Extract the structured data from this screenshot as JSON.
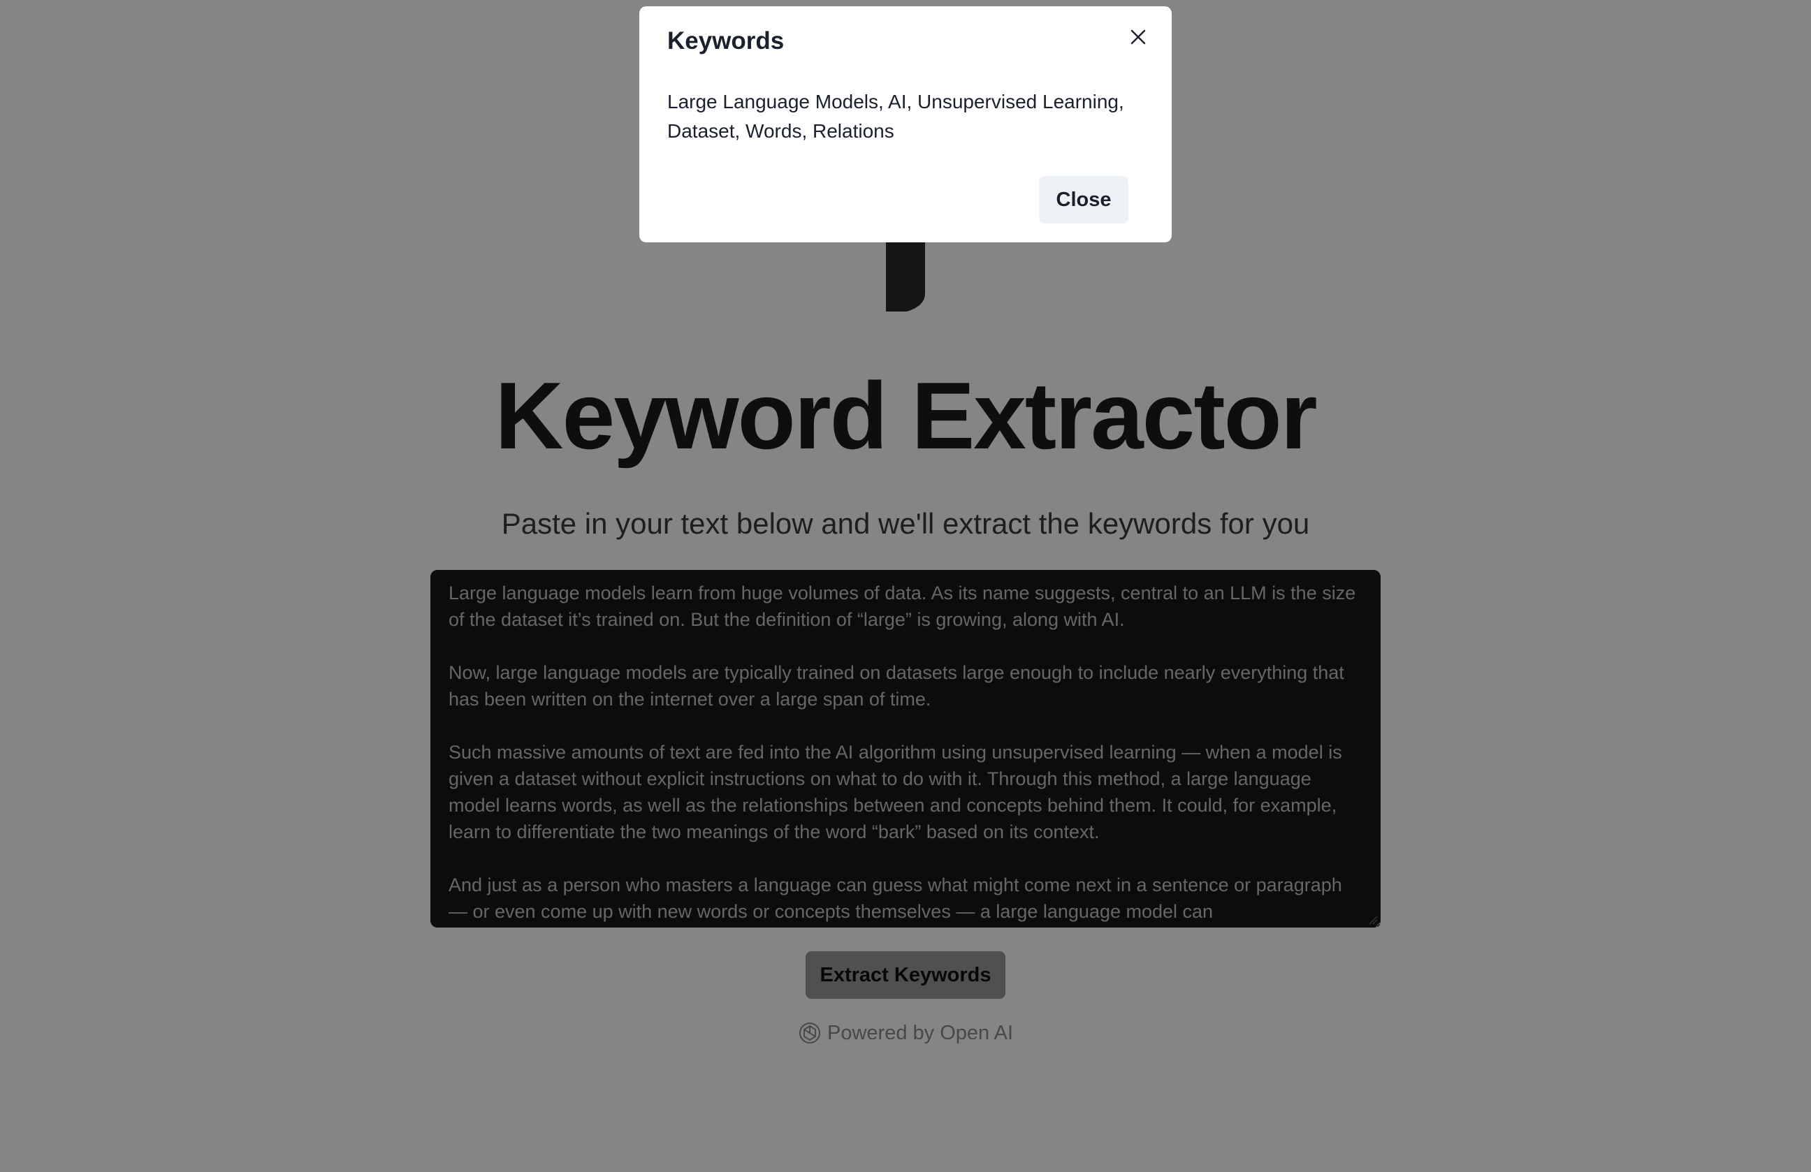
{
  "app": {
    "title": "Keyword Extractor",
    "subtitle": "Paste in your text below and we'll extract the keywords for you",
    "input_text": "Large language models learn from huge volumes of data. As its name suggests, central to an LLM is the size of the dataset it’s trained on. But the definition of “large” is growing, along with AI.\n\nNow, large language models are typically trained on datasets large enough to include nearly everything that has been written on the internet over a large span of time.\n\nSuch massive amounts of text are fed into the AI algorithm using unsupervised learning — when a model is given a dataset without explicit instructions on what to do with it. Through this method, a large language model learns words, as well as the relationships between and concepts behind them. It could, for example, learn to differentiate the two meanings of the word “bark” based on its context.\n\nAnd just as a person who masters a language can guess what might come next in a sentence or paragraph — or even come up with new words or concepts themselves — a large language model can",
    "extract_button_label": "Extract Keywords",
    "powered_by": "Powered by Open AI",
    "powered_icon": "openai-icon",
    "logo_icon": "key-icon"
  },
  "modal": {
    "title": "Keywords",
    "keywords": "Large Language Models, AI, Unsupervised Learning, Dataset, Words, Relations",
    "close_icon": "close-icon",
    "close_button_label": "Close"
  },
  "colors": {
    "page_background": "#ffffff",
    "overlay": "#000000",
    "modal_background": "#ffffff",
    "textarea_background": "#181818",
    "button_background": "#9a9a9a",
    "close_button_background": "#edf2f7"
  }
}
